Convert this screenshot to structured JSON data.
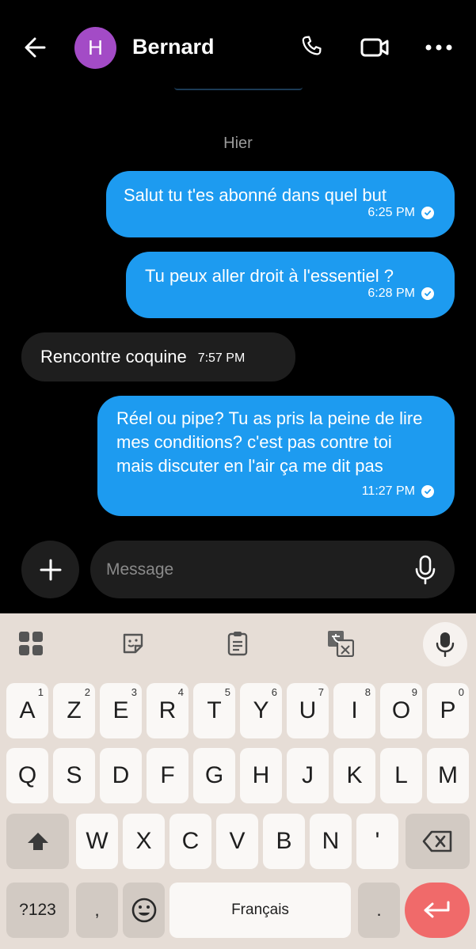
{
  "header": {
    "avatar_initial": "H",
    "contact_name": "Bernard",
    "back_icon": "arrow-left-icon",
    "call_icon": "phone-icon",
    "video_icon": "video-camera-icon",
    "more_icon": "more-horizontal-icon"
  },
  "conversation": {
    "date_separator": "Hier",
    "messages": [
      {
        "direction": "outgoing",
        "text": "Salut tu t'es abonné dans quel but",
        "time": "6:25 PM",
        "status": "read"
      },
      {
        "direction": "outgoing",
        "text": "Tu peux aller droit à l'essentiel ?",
        "time": "6:28 PM",
        "status": "read"
      },
      {
        "direction": "incoming",
        "text": "Rencontre coquine",
        "time": "7:57 PM"
      },
      {
        "direction": "outgoing",
        "text": "Réel ou pipe? Tu as pris la peine de lire mes conditions? c'est pas contre toi mais discuter en l'air ça me dit pas",
        "time": "11:27 PM",
        "status": "read"
      }
    ]
  },
  "composer": {
    "placeholder": "Message",
    "value": ""
  },
  "keyboard": {
    "row1": [
      {
        "label": "A",
        "hint": "1"
      },
      {
        "label": "Z",
        "hint": "2"
      },
      {
        "label": "E",
        "hint": "3"
      },
      {
        "label": "R",
        "hint": "4"
      },
      {
        "label": "T",
        "hint": "5"
      },
      {
        "label": "Y",
        "hint": "6"
      },
      {
        "label": "U",
        "hint": "7"
      },
      {
        "label": "I",
        "hint": "8"
      },
      {
        "label": "O",
        "hint": "9"
      },
      {
        "label": "P",
        "hint": "0"
      }
    ],
    "row2": [
      "Q",
      "S",
      "D",
      "F",
      "G",
      "H",
      "J",
      "K",
      "L",
      "M"
    ],
    "row3": [
      "W",
      "X",
      "C",
      "V",
      "B",
      "N",
      "'"
    ],
    "symbols_label": "?123",
    "comma_label": ",",
    "emoji_icon": "emoji-icon",
    "space_label": "Français",
    "period_label": ".",
    "enter_icon": "enter-icon"
  },
  "colors": {
    "outgoing_bubble": "#1d9bf0",
    "incoming_bubble": "#1e1e1e",
    "avatar": "#a34bc6",
    "enter_key": "#f06a6a"
  }
}
